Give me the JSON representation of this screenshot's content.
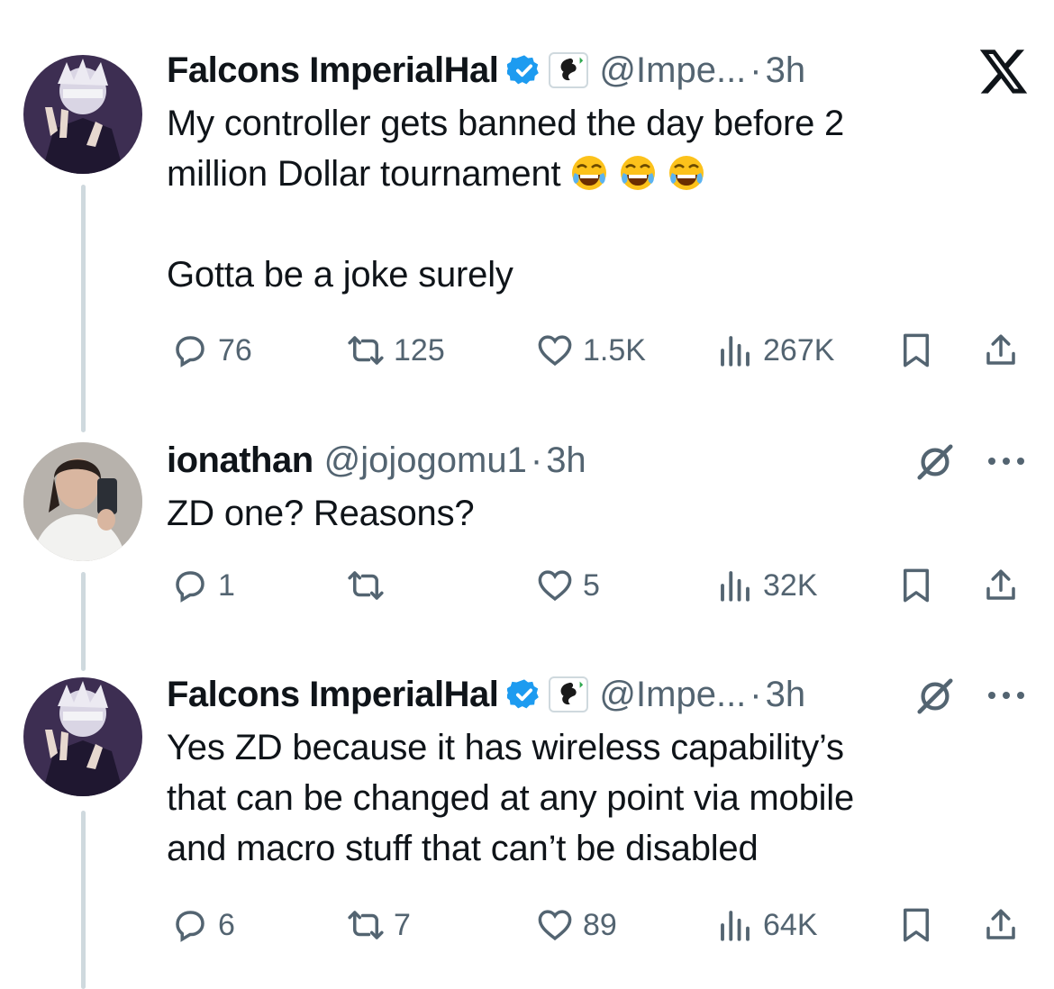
{
  "tweets": [
    {
      "name": "Falcons ImperialHal",
      "handle": "@Impe...",
      "dot": "·",
      "time": "3h",
      "lines": [
        "My controller gets banned the day before 2",
        "million Dollar tournament",
        "Gotta be a joke surely"
      ],
      "emoji": [
        "face-with-tears-of-joy-icon",
        "face-with-tears-of-joy-icon",
        "face-with-tears-of-joy-icon"
      ],
      "replies": "76",
      "reposts": "125",
      "likes": "1.5K",
      "views": "267K"
    },
    {
      "name": "ionathan",
      "handle": "@jojogomu1",
      "dot": "·",
      "time": "3h",
      "lines": [
        "ZD one? Reasons?"
      ],
      "replies": "1",
      "reposts": "",
      "likes": "5",
      "views": "32K"
    },
    {
      "name": "Falcons ImperialHal",
      "handle": "@Impe...",
      "dot": "·",
      "time": "3h",
      "lines": [
        "Yes ZD because it has wireless capability’s",
        "that can be changed at any point via mobile",
        "and macro stuff that can’t be disabled"
      ],
      "replies": "6",
      "reposts": "7",
      "likes": "89",
      "views": "64K"
    }
  ],
  "colors": {
    "verified": "#1d9bf0",
    "muted": "#536471",
    "text": "#0f1419",
    "thread": "#cfd9de"
  }
}
